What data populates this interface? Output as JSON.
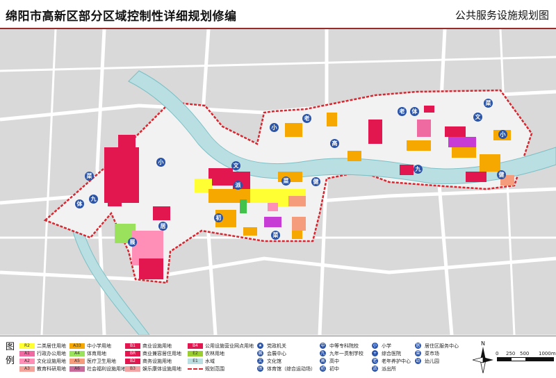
{
  "header": {
    "title": "绵阳市高新区部分区域控制性详细规划修编",
    "subtitle": "公共服务设施规划图"
  },
  "map": {
    "colors": {
      "background": "#d9d9d9",
      "road": "#ffffff",
      "river": "#b9dfe2",
      "river_edge": "#7cc0c6",
      "plan_area": "#f2f2f2",
      "boundary": "#d7262f",
      "commercial": "#e3174f",
      "education": "#f6a800",
      "culture": "#ff8fb6",
      "medical": "#f59c7c",
      "sports": "#9be25c",
      "green": "#42c24a",
      "utility": "#c83cd6",
      "admin": "#ef6aa0",
      "icon": "#2b54a7"
    },
    "labels": [
      {
        "text": "菜",
        "kind": "pin"
      },
      {
        "text": "体",
        "kind": "pin"
      },
      {
        "text": "九",
        "kind": "pin"
      },
      {
        "text": "小",
        "kind": "pin"
      },
      {
        "text": "文",
        "kind": "pin"
      },
      {
        "text": "派",
        "kind": "pin"
      },
      {
        "text": "初",
        "kind": "pin"
      },
      {
        "text": "居",
        "kind": "pin"
      },
      {
        "text": "老",
        "kind": "pin"
      },
      {
        "text": "高",
        "kind": "pin"
      },
      {
        "text": "健",
        "kind": "pin"
      },
      {
        "text": "展",
        "kind": "pin"
      }
    ]
  },
  "legend": {
    "heading": "图例",
    "land_use": [
      {
        "code": "R2",
        "label": "二类居住用地",
        "color": "#ffff33"
      },
      {
        "code": "A1",
        "label": "行政办公用地",
        "color": "#ef6aa0"
      },
      {
        "code": "A2",
        "label": "文化设施用地",
        "color": "#ff8fb6"
      },
      {
        "code": "A3",
        "label": "教育科研用地",
        "color": "#f4a39a"
      },
      {
        "code": "A33",
        "label": "中小学用地",
        "color": "#f6a800"
      },
      {
        "code": "A4",
        "label": "体育用地",
        "color": "#9be25c"
      },
      {
        "code": "A5",
        "label": "医疗卫生用地",
        "color": "#f59c7c"
      },
      {
        "code": "A6",
        "label": "社会福利设施用地",
        "color": "#c86a9a"
      },
      {
        "code": "B1",
        "label": "商业设施用地",
        "color": "#e3174f"
      },
      {
        "code": "BR",
        "label": "商业兼容居住用地",
        "color": "#e3174f"
      },
      {
        "code": "B2",
        "label": "商务设施用地",
        "color": "#e3174f"
      },
      {
        "code": "B3",
        "label": "娱乐康体设施用地",
        "color": "#f2a4a4"
      },
      {
        "code": "B4",
        "label": "公用设施营业网点用地",
        "color": "#e3174f"
      },
      {
        "code": "E2",
        "label": "农林用地",
        "color": "#9acd32"
      },
      {
        "code": "E1",
        "label": "水域",
        "color": "#b9dfe2"
      },
      {
        "code": "",
        "label": "规划范围",
        "color": "#d7262f"
      }
    ],
    "facilities": [
      {
        "label": "党政机关",
        "icon": "★"
      },
      {
        "label": "会展中心",
        "icon": "展"
      },
      {
        "label": "文化馆",
        "icon": "文"
      },
      {
        "label": "体育馆（综合运动场）",
        "icon": "体"
      },
      {
        "label": "中等专科院校",
        "icon": "中"
      },
      {
        "label": "九年一贯制学校",
        "icon": "九"
      },
      {
        "label": "高中",
        "icon": "高"
      },
      {
        "label": "初中",
        "icon": "初"
      },
      {
        "label": "小学",
        "icon": "小"
      },
      {
        "label": "综合医院",
        "icon": "+"
      },
      {
        "label": "老年养护中心",
        "icon": "老"
      },
      {
        "label": "派出所",
        "icon": "派"
      },
      {
        "label": "居住区服务中心",
        "icon": "居"
      },
      {
        "label": "菜市场",
        "icon": "菜"
      },
      {
        "label": "幼儿园",
        "icon": "幼"
      }
    ],
    "scale": {
      "ticks": [
        "0",
        "250",
        "500",
        "1000m"
      ]
    },
    "compass": "N"
  }
}
